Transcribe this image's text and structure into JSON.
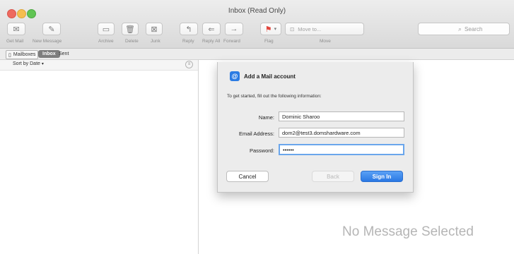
{
  "window": {
    "title": "Inbox (Read Only)"
  },
  "toolbar": {
    "get_mail": "Get Mail",
    "new_message": "New Message",
    "archive": "Archive",
    "delete": "Delete",
    "junk": "Junk",
    "reply": "Reply",
    "reply_all": "Reply All",
    "forward": "Forward",
    "flag": "Flag",
    "move_to": "Move to...",
    "move": "Move",
    "search_placeholder": "Search"
  },
  "favorites": {
    "mailboxes": "Mailboxes",
    "inbox": "Inbox",
    "sent": "Sent"
  },
  "list": {
    "sort_label": "Sort by Date",
    "sort_icon": "chevron-down"
  },
  "viewer": {
    "empty_text": "No Message Selected"
  },
  "dialog": {
    "title": "Add a Mail account",
    "description": "To get started, fill out the following information:",
    "fields": {
      "name_label": "Name:",
      "name_value": "Dominic Sharoo",
      "email_label": "Email Address:",
      "email_value": "dom2@test3.domshardware.com",
      "password_label": "Password:",
      "password_value": "••••••"
    },
    "buttons": {
      "cancel": "Cancel",
      "back": "Back",
      "sign_in": "Sign In"
    }
  },
  "colors": {
    "accent": "#2a78e4",
    "close": "#ee6a5f",
    "minimize": "#f5be4f",
    "zoom": "#61c554"
  }
}
